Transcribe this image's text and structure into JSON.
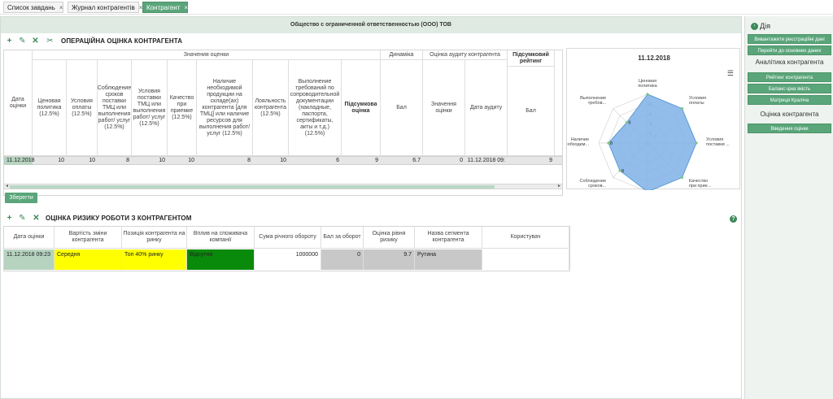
{
  "tabs": [
    {
      "label": "Список завдань",
      "close": "×"
    },
    {
      "label": "Журнал контрагентів",
      "close": "×"
    },
    {
      "label": "Контрагент",
      "close": "×"
    }
  ],
  "company_name": "Общество с ограниченной ответственностью (ООО) ТОВ",
  "operational": {
    "title": "ОПЕРАЦІЙНА ОЦІНКА КОНТРАГЕНТА",
    "group_headers": {
      "values": "Значения оценки",
      "dynamics": "Динаміка",
      "audit": "Оцінка аудиту контрагента",
      "final": "Підсумковий рейтинг"
    },
    "columns": [
      "Дата оцінки",
      "Ценовая политика (12.5%)",
      "Условия оплаты (12.5%)",
      "Соблюдение сроков поставки ТМЦ или выполнения работ/ услуг (12.5%)",
      "Условия поставки ТМЦ или выполнения работ/ услуг (12.5%)",
      "Качество при приемке (12.5%)",
      "Наличие необходимой продукции на складе(ах) контрагента [для ТМЦ] или наличие ресурсов для выполнения работ/услуг (12.5%)",
      "Лояльность контрагента (12.5%)",
      "Выполнение требований по сопроводительной документации (накладные, паспорта, сертификаты, акты и т.д.) (12.5%)",
      "Підсумкова оцінка",
      "Бал",
      "Значення оцінки",
      "Дата аудиту",
      "Бал"
    ],
    "row": [
      "11.12.2018",
      "10",
      "10",
      "8",
      "10",
      "10",
      "8",
      "10",
      "6",
      "9",
      "6.7",
      "0",
      "11.12.2018 09:",
      "9"
    ],
    "save_label": "Зберегти",
    "scroll_left": "◄",
    "scroll_right": "►"
  },
  "chart_data": {
    "type": "radar",
    "title": "11.12.2018",
    "categories": [
      "Ценовая политика",
      "Условия оплаты",
      "Условия поставки ...",
      "Качество при прие...",
      "Лояльность контра...",
      "Соблюдение сроков...",
      "Наличие необходим...",
      "Выполнение требов..."
    ],
    "values": [
      10,
      10,
      10,
      10,
      10,
      8,
      8,
      6
    ],
    "ylim": [
      0,
      10
    ],
    "ticks": [
      "2",
      "4",
      "6",
      "8"
    ],
    "point_labels": [
      "",
      "",
      "",
      "",
      "",
      "8",
      "8",
      "6"
    ],
    "colors": {
      "fill": "#7fb2e8",
      "stroke": "#5c9bd8",
      "point": "#7cc47e"
    }
  },
  "risk": {
    "title": "ОЦІНКА РИЗИКУ РОБОТИ З КОНТРАГЕНТОМ",
    "columns": [
      "Дата оцінки",
      "Вартість зміни контрагента",
      "Позиція контрагента на ринку",
      "Вплив на споживача компанії",
      "Сума річного обороту",
      "Бал за оборот",
      "Оцінка рівня ризику",
      "Назва сегмента контрагента",
      "Користувач"
    ],
    "row": [
      "11.12.2018 09:23",
      "Середня",
      "Топ 40% ринку",
      "Відсутня",
      "1000000",
      "0",
      "9.7",
      "Рутина",
      ""
    ],
    "colors": {
      "yellow": "#ffff00",
      "green": "#0a8a0a",
      "grey": "#c8c8c8",
      "date_bg": "#b6d3c0"
    },
    "help": "?"
  },
  "side": {
    "actions_label": "Дія",
    "buttons_top": [
      "Вивантажити реєстраційні дані",
      "Перейти до основних даних"
    ],
    "analytics_label": "Аналітика контрагента",
    "buttons_analytics": [
      "Рейтинг контрагента",
      "Баланс ціна якість",
      "Матриця Краліча"
    ],
    "assessment_label": "Оцінка контрагента",
    "buttons_assessment": [
      "Введення оцінки"
    ]
  }
}
